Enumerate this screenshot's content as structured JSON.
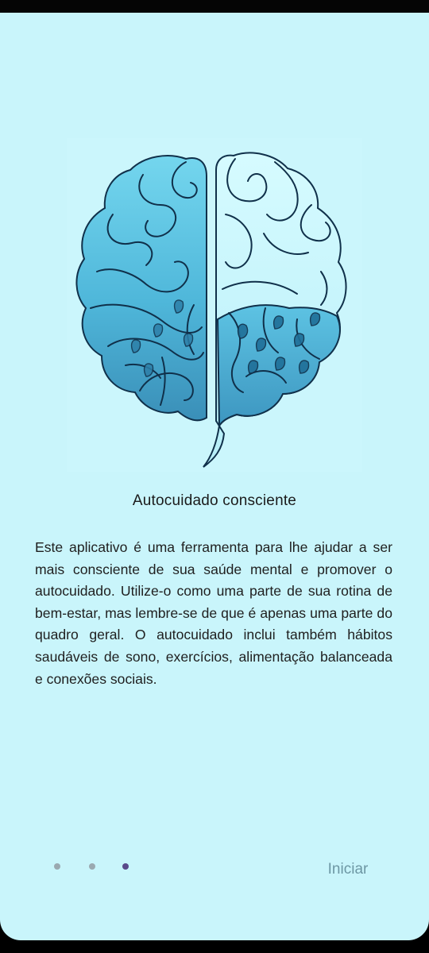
{
  "onboarding": {
    "title": "Autocuidado consciente",
    "body": "Este aplicativo é uma ferramenta para lhe ajudar a ser mais consciente de sua saúde mental e promover o autocuidado. Utilize-o como uma parte de sua rotina de bem-estar, mas lembre-se de que é apenas uma parte do quadro geral. O autocuidado inclui também hábitos saudáveis de sono, exercícios, alimentação balanceada e conexões sociais.",
    "illustration_icon": "brain-icon",
    "page_indicator": {
      "total": 3,
      "current": 3
    },
    "start_label": "Iniciar"
  },
  "colors": {
    "background": "#c9f5fb",
    "brain_fill_top": "#6fd3ec",
    "brain_fill_bottom": "#3a96bd",
    "outline": "#10304a",
    "dot_inactive": "#9aa9b0",
    "dot_active": "#5a4a8a",
    "start_text": "#6d97a4"
  }
}
